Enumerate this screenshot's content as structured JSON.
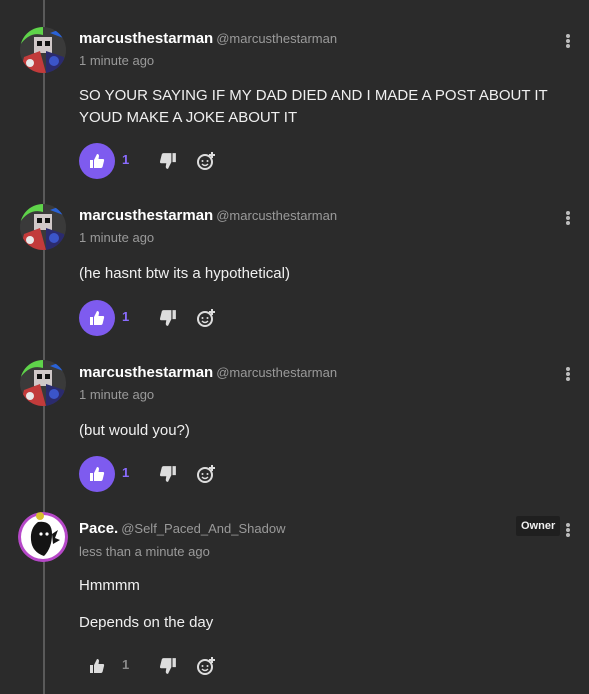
{
  "comments": [
    {
      "username": "marcusthestarman",
      "handle": "@marcusthestarman",
      "time": "1 minute ago",
      "lines": [
        "SO YOUR SAYING IF MY DAD DIED AND I MADE A POST ABOUT IT",
        "YOUD MAKE A JOKE ABOUT IT"
      ],
      "likes": "1",
      "liked": true
    },
    {
      "username": "marcusthestarman",
      "handle": "@marcusthestarman",
      "time": "1 minute ago",
      "lines": [
        "(he hasnt btw its a hypothetical)"
      ],
      "likes": "1",
      "liked": true
    },
    {
      "username": "marcusthestarman",
      "handle": "@marcusthestarman",
      "time": "1 minute ago",
      "lines": [
        "(but would you?)"
      ],
      "likes": "1",
      "liked": true
    },
    {
      "username": "Pace.",
      "handle": "@Self_Paced_And_Shadow",
      "time": "less than a minute ago",
      "badge": "Owner",
      "lines": [
        "Hmmmm",
        "Depends on the day"
      ],
      "likes": "1",
      "liked": false
    }
  ],
  "icons": {
    "like": "thumbs-up-icon",
    "dislike": "thumbs-down-icon",
    "react": "add-reaction-icon",
    "menu": "more-vertical-icon"
  },
  "colors": {
    "background": "#2b2b2b",
    "accent": "#7e5bef",
    "muted_text": "#9a9a9a"
  }
}
